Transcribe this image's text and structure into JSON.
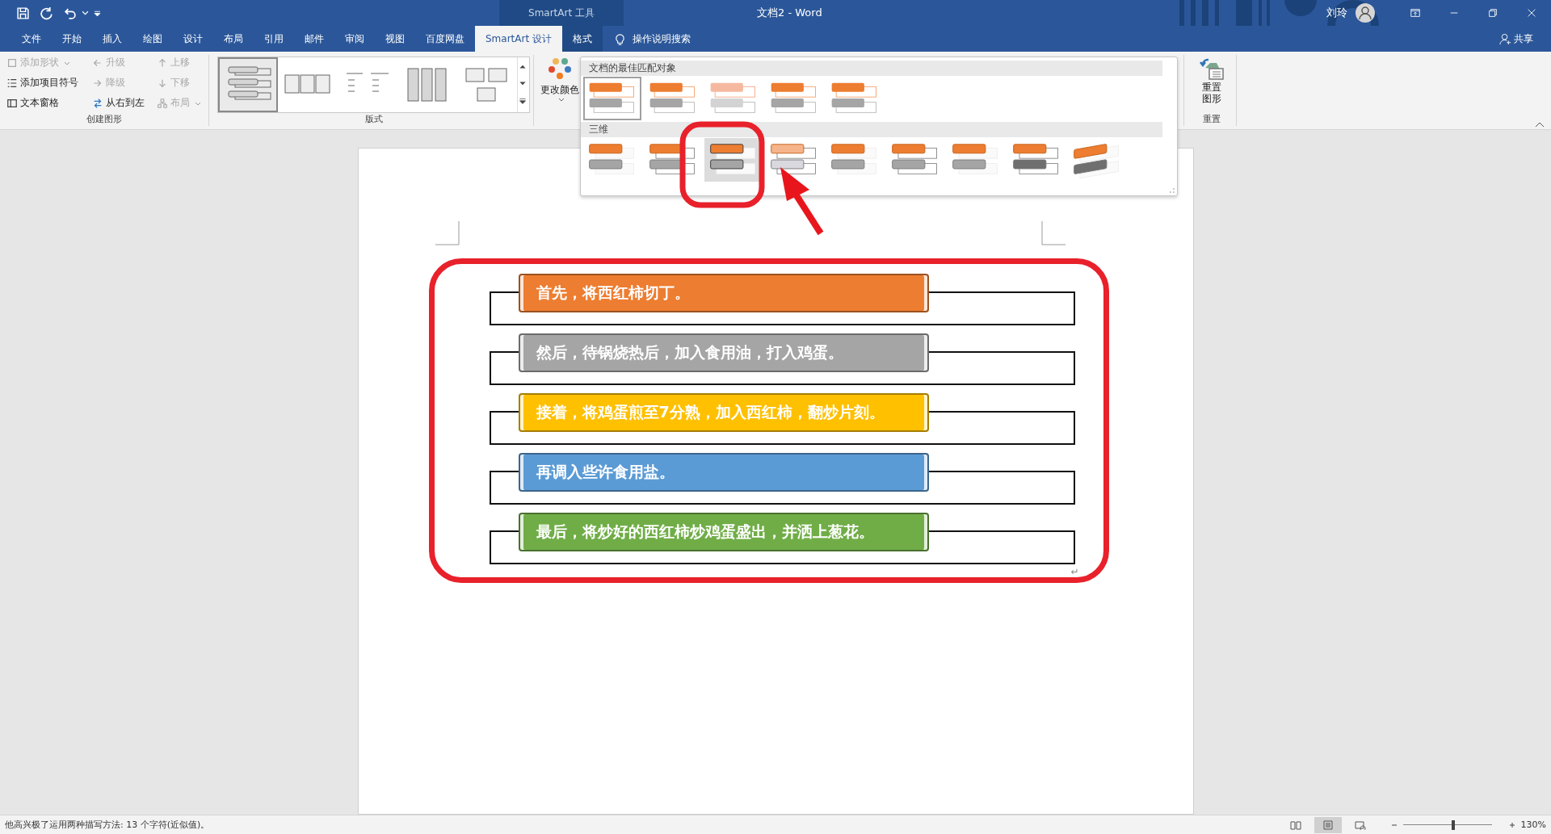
{
  "window": {
    "title": "文档2  -  Word",
    "context_title": "SmartArt 工具",
    "user": "刘玲",
    "share": "共享"
  },
  "tabs": [
    {
      "label": "文件",
      "selected": false
    },
    {
      "label": "开始",
      "selected": false
    },
    {
      "label": "插入",
      "selected": false
    },
    {
      "label": "绘图",
      "selected": false
    },
    {
      "label": "设计",
      "selected": false
    },
    {
      "label": "布局",
      "selected": false
    },
    {
      "label": "引用",
      "selected": false
    },
    {
      "label": "邮件",
      "selected": false
    },
    {
      "label": "审阅",
      "selected": false
    },
    {
      "label": "视图",
      "selected": false
    },
    {
      "label": "百度网盘",
      "selected": false
    },
    {
      "label": "SmartArt 设计",
      "selected": true
    },
    {
      "label": "格式",
      "selected": false
    }
  ],
  "tell_me": "操作说明搜索",
  "create_group": {
    "label": "创建图形",
    "commands": [
      {
        "label": "添加形状",
        "kind": "add-shape",
        "disabled": true,
        "dropdown": true
      },
      {
        "label": "升级",
        "kind": "promote",
        "disabled": true,
        "dropdown": false
      },
      {
        "label": "上移",
        "kind": "move-up",
        "disabled": true,
        "dropdown": false
      },
      {
        "label": "添加项目符号",
        "kind": "bullet",
        "disabled": false,
        "dropdown": false
      },
      {
        "label": "降级",
        "kind": "demote",
        "disabled": true,
        "dropdown": false
      },
      {
        "label": "下移",
        "kind": "move-down",
        "disabled": true,
        "dropdown": false
      },
      {
        "label": "文本窗格",
        "kind": "text-pane",
        "disabled": false,
        "dropdown": false
      },
      {
        "label": "从右到左",
        "kind": "rtl",
        "disabled": false,
        "dropdown": false
      },
      {
        "label": "布局",
        "kind": "layout",
        "disabled": true,
        "dropdown": true
      }
    ]
  },
  "layouts_group": {
    "label": "版式",
    "layouts": [
      {
        "kind": "stacked",
        "selected": true
      },
      {
        "kind": "cards",
        "selected": false
      },
      {
        "kind": "tree",
        "selected": false
      },
      {
        "kind": "columns",
        "selected": false
      },
      {
        "kind": "tiles",
        "selected": false
      }
    ]
  },
  "change_colors": "更改颜色",
  "reset_group": {
    "label": "重置",
    "button": "重置图形"
  },
  "styles_gallery": {
    "sections": [
      {
        "title": "文档的最佳匹配对象",
        "kind": "flat",
        "items": [
          {
            "selected": true,
            "hovered": false
          },
          {
            "selected": false,
            "hovered": false
          },
          {
            "selected": false,
            "hovered": false
          },
          {
            "selected": false,
            "hovered": false
          },
          {
            "selected": false,
            "hovered": false
          }
        ]
      },
      {
        "title": "三维",
        "kind": "raised",
        "items": [
          {
            "selected": false,
            "hovered": false
          },
          {
            "selected": false,
            "hovered": false
          },
          {
            "selected": false,
            "hovered": true
          },
          {
            "selected": false,
            "hovered": false
          },
          {
            "selected": false,
            "hovered": false
          },
          {
            "selected": false,
            "hovered": false
          },
          {
            "selected": false,
            "hovered": false
          },
          {
            "selected": false,
            "hovered": false
          },
          {
            "selected": false,
            "hovered": false
          }
        ]
      }
    ]
  },
  "diagram": {
    "items": [
      {
        "text": "首先，将西红柿切丁。",
        "color": "#ed7d31"
      },
      {
        "text": "然后，待锅烧热后，加入食用油，打入鸡蛋。",
        "color": "#a5a5a5"
      },
      {
        "text": "接着，将鸡蛋煎至7分熟，加入西红柿，翻炒片刻。",
        "color": "#ffc000"
      },
      {
        "text": "再调入些许食用盐。",
        "color": "#5b9bd5"
      },
      {
        "text": "最后，将炒好的西红柿炒鸡蛋盛出，并洒上葱花。",
        "color": "#70ad47"
      }
    ],
    "paragraph_mark": "↵"
  },
  "status_bar": {
    "text": "他高兴极了运用两种描写方法: 13 个字符(近似值)。",
    "zoom": "130%",
    "zoom_slider": {
      "level": 0.57
    },
    "views": [
      {
        "kind": "read",
        "selected": false
      },
      {
        "kind": "print",
        "selected": true
      },
      {
        "kind": "web",
        "selected": false
      }
    ]
  }
}
